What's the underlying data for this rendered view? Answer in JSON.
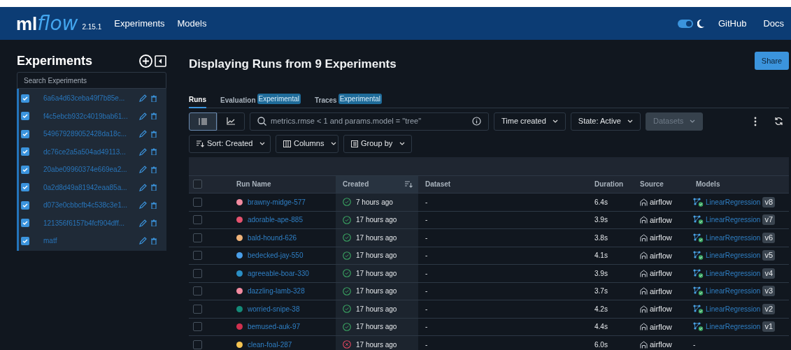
{
  "header": {
    "logo_text": "ml",
    "logo_script": "flow",
    "version": "2.15.1",
    "nav": [
      {
        "label": "Experiments"
      },
      {
        "label": "Models"
      }
    ],
    "dark_mode": true,
    "links": [
      {
        "label": "GitHub"
      },
      {
        "label": "Docs"
      }
    ]
  },
  "sidebar": {
    "title": "Experiments",
    "search": {
      "placeholder": "Search Experiments"
    },
    "items": [
      {
        "name": "6a6a4d63ceba49f7b85e...",
        "checked": true
      },
      {
        "name": "f4c5ebcb932c4019bab61...",
        "checked": true
      },
      {
        "name": "549679289052428da18c...",
        "checked": true
      },
      {
        "name": "dc76ce2a5a504ad49113...",
        "checked": true
      },
      {
        "name": "20abe09960374e669ea2...",
        "checked": true
      },
      {
        "name": "0a2d8d49a81942eaa85a...",
        "checked": true
      },
      {
        "name": "d073e0cbbcfb4c538c3e1...",
        "checked": true
      },
      {
        "name": "121356f6157b4fcf904dff...",
        "checked": true
      },
      {
        "name": "matf",
        "checked": true
      }
    ]
  },
  "main": {
    "title": "Displaying Runs from 9 Experiments",
    "share": "Share",
    "tabs": [
      {
        "label": "Runs",
        "selected": true
      },
      {
        "label": "Evaluation",
        "badge": "Experimental",
        "selected": false
      },
      {
        "label": "Traces",
        "badge": "Experimental",
        "selected": false
      }
    ],
    "view_toggle": [
      {
        "kind": "table",
        "selected": true
      },
      {
        "kind": "chart",
        "selected": false
      }
    ],
    "search": {
      "placeholder": "metrics.rmse < 1 and params.model = \"tree\""
    },
    "filters": [
      {
        "label": "Time created",
        "disabled": false
      },
      {
        "label": "State: Active",
        "disabled": false
      },
      {
        "label": "Datasets",
        "disabled": true
      }
    ],
    "controls": [
      {
        "kind": "sort",
        "label": "Sort: Created"
      },
      {
        "kind": "columns",
        "label": "Columns"
      },
      {
        "kind": "group",
        "label": "Group by"
      }
    ],
    "table": {
      "select_all": {
        "checked": false
      },
      "columns": [
        "Run Name",
        "Created",
        "Dataset",
        "Duration",
        "Source",
        "Models"
      ],
      "rows": [
        {
          "color": "#f28ba0",
          "name": "brawny-midge-577",
          "checked": false,
          "kind": "finished",
          "created": "7 hours ago",
          "dataset": "-",
          "duration": "6.4s",
          "source": "airflow",
          "model": "LinearRegression",
          "version": "v8"
        },
        {
          "color": "#e5526e",
          "name": "adorable-ape-885",
          "checked": false,
          "kind": "finished",
          "created": "17 hours ago",
          "dataset": "-",
          "duration": "3.9s",
          "source": "airflow",
          "model": "LinearRegression",
          "version": "v7"
        },
        {
          "color": "#f0b47a",
          "name": "bald-hound-626",
          "checked": false,
          "kind": "finished",
          "created": "17 hours ago",
          "dataset": "-",
          "duration": "3.8s",
          "source": "airflow",
          "model": "LinearRegression",
          "version": "v6"
        },
        {
          "color": "#4a9ee8",
          "name": "bedecked-jay-550",
          "checked": false,
          "kind": "finished",
          "created": "17 hours ago",
          "dataset": "-",
          "duration": "4.1s",
          "source": "airflow",
          "model": "LinearRegression",
          "version": "v5"
        },
        {
          "color": "#2a8ec4",
          "name": "agreeable-boar-330",
          "checked": false,
          "kind": "finished",
          "created": "17 hours ago",
          "dataset": "-",
          "duration": "3.9s",
          "source": "airflow",
          "model": "LinearRegression",
          "version": "v4"
        },
        {
          "color": "#f28ba0",
          "name": "dazzling-lamb-328",
          "checked": false,
          "kind": "finished",
          "created": "17 hours ago",
          "dataset": "-",
          "duration": "3.7s",
          "source": "airflow",
          "model": "LinearRegression",
          "version": "v3"
        },
        {
          "color": "#148a78",
          "name": "worried-snipe-38",
          "checked": false,
          "kind": "finished",
          "created": "17 hours ago",
          "dataset": "-",
          "duration": "4.2s",
          "source": "airflow",
          "model": "LinearRegression",
          "version": "v2"
        },
        {
          "color": "#d0304f",
          "name": "bemused-auk-97",
          "checked": false,
          "kind": "finished",
          "created": "17 hours ago",
          "dataset": "-",
          "duration": "4.4s",
          "source": "airflow",
          "model": "LinearRegression",
          "version": "v1"
        },
        {
          "color": "#f5c451",
          "name": "clean-foal-287",
          "checked": false,
          "kind": "failed",
          "created": "17 hours ago",
          "dataset": "-",
          "duration": "6.0s",
          "source": "airflow",
          "model": "-"
        }
      ]
    }
  }
}
